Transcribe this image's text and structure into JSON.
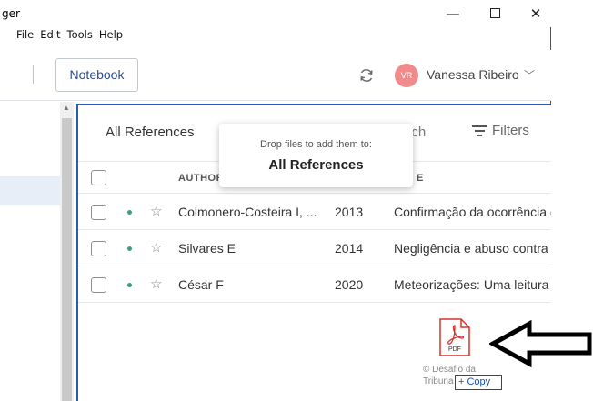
{
  "window": {
    "title": "ger",
    "minimize": "—",
    "close": "✕"
  },
  "menu": [
    "File",
    "Edit",
    "Tools",
    "Help"
  ],
  "toolbar": {
    "notebook_label": "Notebook",
    "sync_icon": "sync-icon",
    "user_initials": "VR",
    "user_name": "Vanessa Ribeiro",
    "user_chevron": "﹀"
  },
  "panel": {
    "title": "All References",
    "search_text": "irch",
    "filters_label": "Filters",
    "columns": {
      "author": "AUTHOR",
      "title": "E"
    },
    "rows": [
      {
        "author": "Colmonero-Costeira I, ...",
        "year": "2013",
        "title": "Confirmação da ocorrência d"
      },
      {
        "author": "Silvares E",
        "year": "2014",
        "title": "Negligência e abuso contra c"
      },
      {
        "author": "César F",
        "year": "2020",
        "title": "Meteorizações: Uma leitura"
      }
    ]
  },
  "drop_tooltip": {
    "line1": "Drop files to add them to:",
    "line2": "All References"
  },
  "drag": {
    "icon_label": "PDF",
    "file_label": "© Desafio da Tribuna",
    "copy_label": "+ Copy"
  },
  "colors": {
    "accent": "#2c5bb4",
    "avatar": "#f08b8b",
    "pdf_red": "#d9322b",
    "dot_green": "#3aa07a"
  }
}
